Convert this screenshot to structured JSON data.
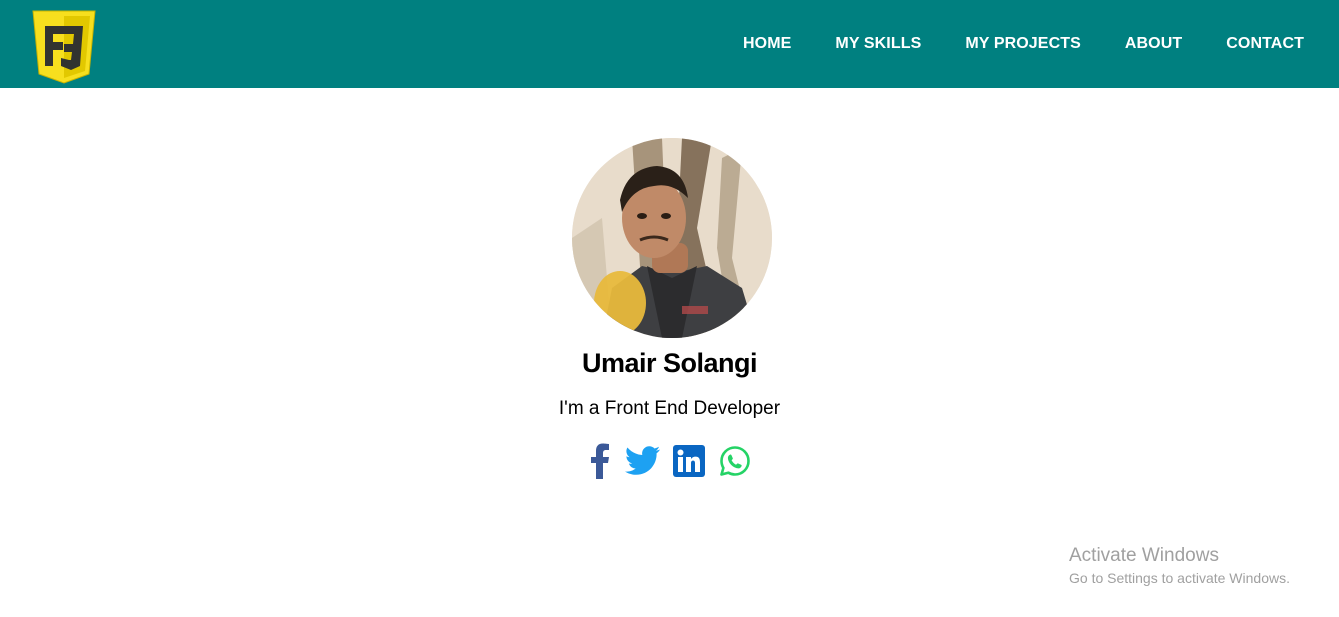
{
  "navbar": {
    "background": "#008080",
    "logo_icon": "css3-style-shield-logo",
    "links": [
      "HOME",
      "MY SKILLS",
      "MY PROJECTS",
      "ABOUT",
      "CONTACT"
    ]
  },
  "profile": {
    "avatar": "profile-photo",
    "name": "Umair Solangi",
    "tagline": "I'm a Front End Developer"
  },
  "socials": [
    {
      "icon": "facebook-icon",
      "color": "#3b5998"
    },
    {
      "icon": "twitter-icon",
      "color": "#1da1f2"
    },
    {
      "icon": "linkedin-icon",
      "color": "#0a66c2"
    },
    {
      "icon": "whatsapp-icon",
      "color": "#25d366"
    }
  ],
  "watermark": {
    "title": "Activate Windows",
    "subtitle": "Go to Settings to activate Windows."
  }
}
